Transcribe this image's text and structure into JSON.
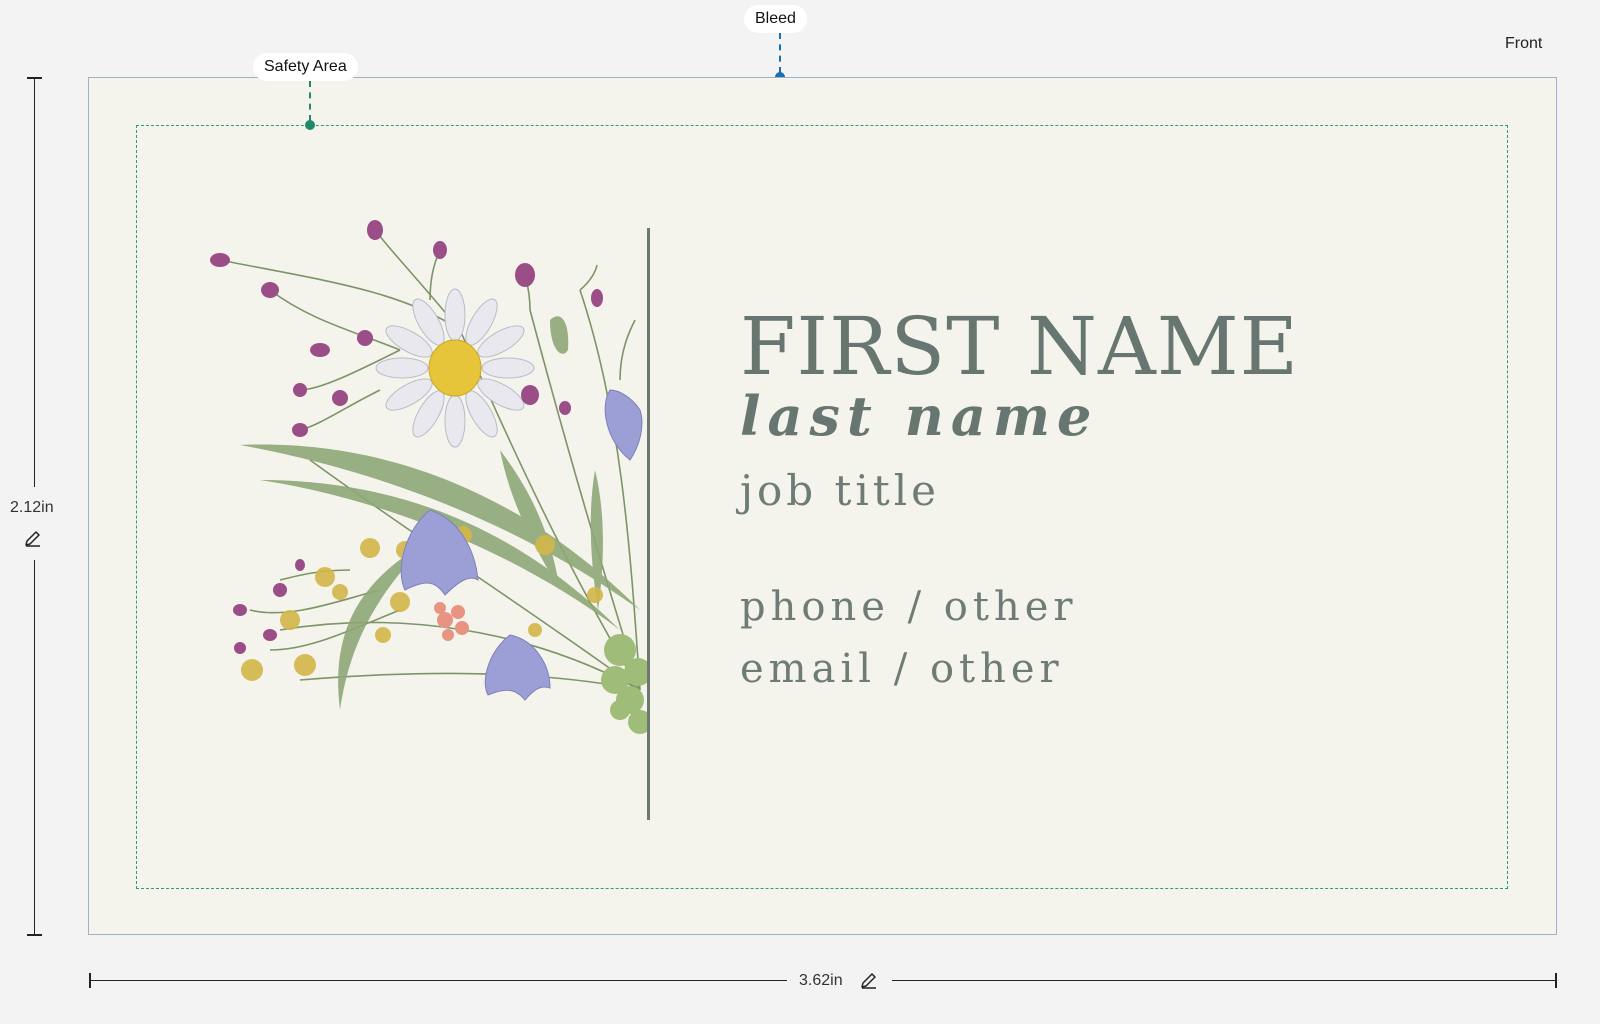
{
  "labels": {
    "bleed": "Bleed",
    "safety_area": "Safety Area",
    "side": "Front"
  },
  "dimensions": {
    "height": "2.12in",
    "width": "3.62in"
  },
  "card": {
    "first_name": "FIRST NAME",
    "last_name": "last name",
    "job_title": "job title",
    "phone": "phone / other",
    "email": "email / other"
  },
  "icons": {
    "edit_height": "pencil-icon",
    "edit_width": "pencil-icon",
    "illustration": "wildflower-bouquet"
  },
  "colors": {
    "bleed_marker": "#1a6fb0",
    "safety_marker": "#1f8a6a",
    "text": "#677671",
    "card_background": "#f4f4ec"
  }
}
